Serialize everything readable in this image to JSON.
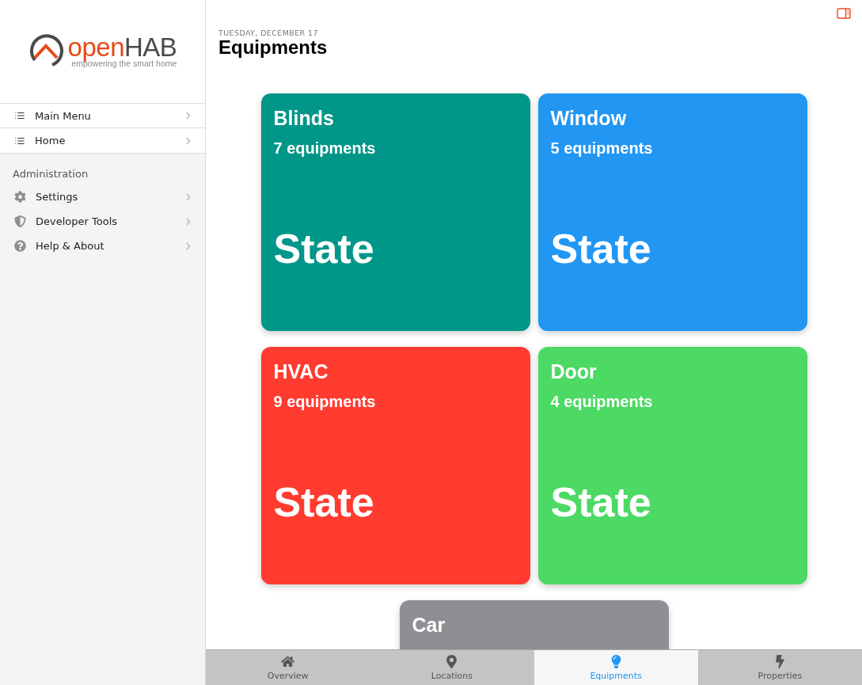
{
  "sidebar": {
    "logo": {
      "word_start": "open",
      "word_end": "HAB",
      "tagline": "empowering the smart home"
    },
    "menu_items": [
      {
        "label": "Main Menu"
      },
      {
        "label": "Home"
      }
    ],
    "admin_title": "Administration",
    "admin_items": [
      {
        "label": "Settings"
      },
      {
        "label": "Developer Tools"
      },
      {
        "label": "Help & About"
      }
    ]
  },
  "header": {
    "date": "TUESDAY, DECEMBER 17",
    "title": "Equipments"
  },
  "cards": [
    {
      "name": "Blinds",
      "count": "7 equipments",
      "state": "State",
      "color": "#009688"
    },
    {
      "name": "Window",
      "count": "5 equipments",
      "state": "State",
      "color": "#2196f3"
    },
    {
      "name": "HVAC",
      "count": "9 equipments",
      "state": "State",
      "color": "#ff3b30"
    },
    {
      "name": "Door",
      "count": "4 equipments",
      "state": "State",
      "color": "#4cd964"
    },
    {
      "name": "Car",
      "color": "#8e8e93"
    }
  ],
  "tabs": [
    {
      "label": "Overview",
      "selected": false
    },
    {
      "label": "Locations",
      "selected": false
    },
    {
      "label": "Equipments",
      "selected": true
    },
    {
      "label": "Properties",
      "selected": false
    }
  ]
}
